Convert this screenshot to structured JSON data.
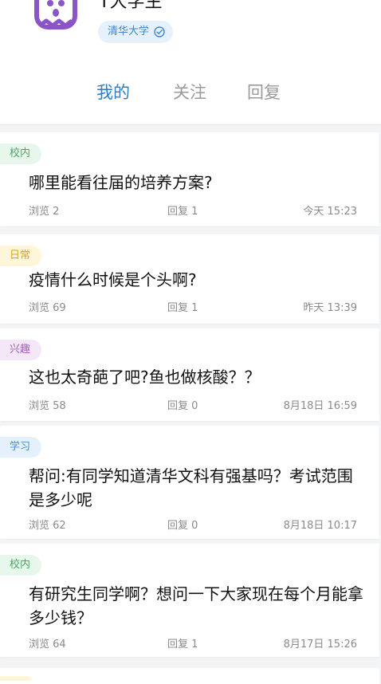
{
  "profile": {
    "username": "T大学生",
    "school": "清华大学"
  },
  "tabs": [
    {
      "label": "我的",
      "active": true
    },
    {
      "label": "关注",
      "active": false
    },
    {
      "label": "回复",
      "active": false
    }
  ],
  "posts": [
    {
      "tag": "校内",
      "title": "哪里能看往届的培养方案?",
      "views": "浏览 2",
      "replies": "回复 1",
      "time": "今天 15:23"
    },
    {
      "tag": "日常",
      "title": "疫情什么时候是个头啊?",
      "views": "浏览 69",
      "replies": "回复 1",
      "time": "昨天 13:39"
    },
    {
      "tag": "兴趣",
      "title": "这也太奇葩了吧?鱼也做核酸？？",
      "views": "浏览 58",
      "replies": "回复 0",
      "time": "8月18日 16:59"
    },
    {
      "tag": "学习",
      "title": "帮问:有同学知道清华文科有强基吗？考试范围是多少呢",
      "views": "浏览 62",
      "replies": "回复 0",
      "time": "8月18日 10:17"
    },
    {
      "tag": "校内",
      "title": "有研究生同学啊？想问一下大家现在每个月能拿多少钱？",
      "views": "浏览 64",
      "replies": "回复 1",
      "time": "8月17日 15:26"
    }
  ]
}
